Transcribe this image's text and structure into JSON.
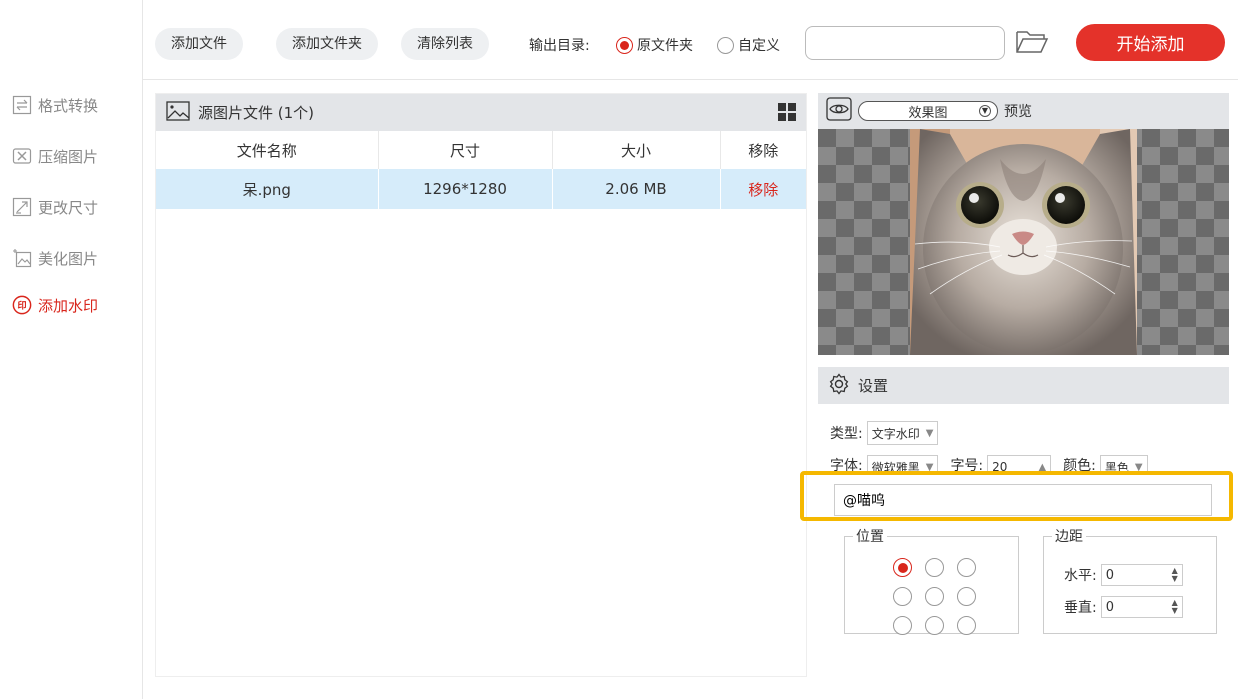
{
  "sidebar": {
    "items": [
      {
        "label": "格式转换",
        "icon": "swap-icon"
      },
      {
        "label": "压缩图片",
        "icon": "compress-icon"
      },
      {
        "label": "更改尺寸",
        "icon": "resize-icon"
      },
      {
        "label": "美化图片",
        "icon": "sparkle-image-icon"
      },
      {
        "label": "添加水印",
        "icon": "stamp-icon",
        "active": true
      }
    ]
  },
  "toolbar": {
    "add_file": "添加文件",
    "add_folder": "添加文件夹",
    "clear_list": "清除列表",
    "output_label": "输出目录:",
    "radio_original": "原文件夹",
    "radio_custom": "自定义",
    "output_path": "",
    "start": "开始添加"
  },
  "files": {
    "header": "源图片文件 (1个)",
    "columns": [
      "文件名称",
      "尺寸",
      "大小",
      "移除"
    ],
    "rows": [
      {
        "name": "呆.png",
        "dims": "1296*1280",
        "size": "2.06 MB",
        "remove": "移除"
      }
    ]
  },
  "preview": {
    "mode": "效果图",
    "label": "预览"
  },
  "settings": {
    "title": "设置",
    "type_label": "类型:",
    "type_value": "文字水印",
    "font_label": "字体:",
    "font_value": "微软雅黑",
    "size_label": "字号:",
    "size_value": "20",
    "color_label": "颜色:",
    "color_value": "黑色",
    "watermark_text": "@喵呜",
    "position_legend": "位置",
    "margin_legend": "边距",
    "horizontal_label": "水平:",
    "horizontal_value": "0",
    "vertical_label": "垂直:",
    "vertical_value": "0"
  },
  "colors": {
    "accent": "#e4322a",
    "highlight": "#f5b800",
    "selected_row": "#d6ecfa"
  }
}
